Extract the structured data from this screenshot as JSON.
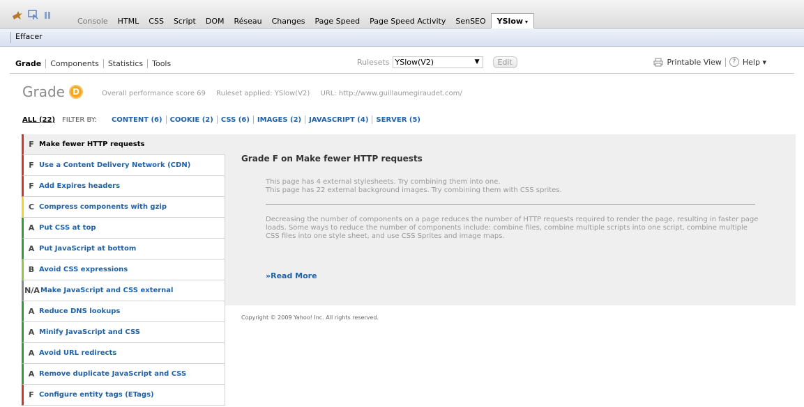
{
  "firebug": {
    "tabs": [
      {
        "label": "Console",
        "muted": true
      },
      {
        "label": "HTML"
      },
      {
        "label": "CSS"
      },
      {
        "label": "Script"
      },
      {
        "label": "DOM"
      },
      {
        "label": "Réseau"
      },
      {
        "label": "Changes"
      },
      {
        "label": "Page Speed"
      },
      {
        "label": "Page Speed Activity"
      },
      {
        "label": "SenSEO"
      },
      {
        "label": "YSlow",
        "active": true
      }
    ],
    "active_caret": "▾"
  },
  "effacer": {
    "label": "Effacer"
  },
  "yslow": {
    "nav": [
      "Grade",
      "Components",
      "Statistics",
      "Tools"
    ],
    "rulesets_label": "Rulesets",
    "ruleset_value": "YSlow(V2)",
    "edit_label": "Edit",
    "printable_label": "Printable View",
    "help_label": "Help ▾"
  },
  "grade": {
    "word": "Grade",
    "letter": "D",
    "score_text": "Overall performance score 69",
    "ruleset_text": "Ruleset applied: YSlow(V2)",
    "url_text": "URL: http://www.guillaumegiraudet.com/",
    "accent": "#f7a61b"
  },
  "filter": {
    "all": "ALL (22)",
    "by": "FILTER BY:",
    "items": [
      "CONTENT (6)",
      "COOKIE (2)",
      "CSS (6)",
      "IMAGES (2)",
      "JAVASCRIPT (4)",
      "SERVER (5)"
    ]
  },
  "rules": [
    {
      "grade": "F",
      "title": "Make fewer HTTP requests",
      "cls": "gF",
      "selected": true
    },
    {
      "grade": "F",
      "title": "Use a Content Delivery Network (CDN)",
      "cls": "gF"
    },
    {
      "grade": "F",
      "title": "Add Expires headers",
      "cls": "gF"
    },
    {
      "grade": "C",
      "title": "Compress components with gzip",
      "cls": "gC"
    },
    {
      "grade": "A",
      "title": "Put CSS at top",
      "cls": "gA"
    },
    {
      "grade": "A",
      "title": "Put JavaScript at bottom",
      "cls": "gA"
    },
    {
      "grade": "B",
      "title": "Avoid CSS expressions",
      "cls": "gB"
    },
    {
      "grade": "N/A",
      "title": "Make JavaScript and CSS external",
      "cls": "gNA"
    },
    {
      "grade": "A",
      "title": "Reduce DNS lookups",
      "cls": "gA"
    },
    {
      "grade": "A",
      "title": "Minify JavaScript and CSS",
      "cls": "gA"
    },
    {
      "grade": "A",
      "title": "Avoid URL redirects",
      "cls": "gA"
    },
    {
      "grade": "A",
      "title": "Remove duplicate JavaScript and CSS",
      "cls": "gA"
    },
    {
      "grade": "F",
      "title": "Configure entity tags (ETags)",
      "cls": "gF"
    }
  ],
  "detail": {
    "title": "Grade F on Make fewer HTTP requests",
    "msg1": "This page has 4 external stylesheets. Try combining them into one.",
    "msg2": "This page has 22 external background images. Try combining them with CSS sprites.",
    "description": "Decreasing the number of components on a page reduces the number of HTTP requests required to render the page, resulting in faster page loads. Some ways to reduce the number of components include: combine files, combine multiple scripts into one script, combine multiple CSS files into one style sheet, and use CSS Sprites and image maps.",
    "read_more": "»Read More"
  },
  "copyright": "Copyright © 2009 Yahoo! Inc. All rights reserved."
}
